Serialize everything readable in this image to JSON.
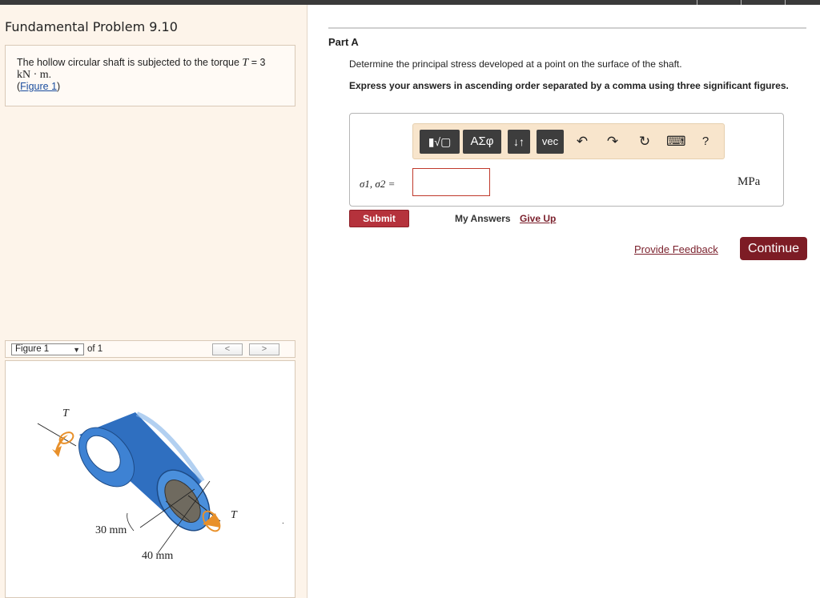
{
  "problem": {
    "title": "Fundamental Problem 9.10",
    "text_prefix": "The hollow circular shaft is subjected to the torque",
    "symbol": "T",
    "equals": "= 3",
    "unit": "kN · m",
    "figure_link": "Figure 1"
  },
  "figure_nav": {
    "select_value": "Figure 1",
    "of_label": "of 1",
    "prev": "<",
    "next": ">"
  },
  "figure": {
    "torque_label_left": "T",
    "torque_label_right": "T",
    "inner_dim": "30 mm",
    "outer_dim": "40 mm"
  },
  "part": {
    "title": "Part A",
    "question": "Determine the principal stress developed at a point on the surface of the shaft.",
    "instructions": "Express your answers in ascending order separated by a comma using three significant figures."
  },
  "toolbar": {
    "templates": "▮√▢",
    "greek": "ΑΣφ",
    "arrows": "↓↑",
    "vec": "vec",
    "undo": "↶",
    "redo": "↷",
    "reset": "↻",
    "keyboard": "⌨",
    "help": "?"
  },
  "answer": {
    "label": "σ1, σ2 =",
    "value": "",
    "unit": "MPa"
  },
  "actions": {
    "submit": "Submit",
    "my_answers": "My Answers",
    "give_up": "Give Up",
    "feedback": "Provide Feedback",
    "continue": "Continue"
  },
  "colors": {
    "left_panel": "#fdf4ea",
    "submit": "#b5323c",
    "continue": "#7d1c25",
    "toolbar": "#f8e5cc",
    "shaft": "#2f6fc0",
    "torque_arrow": "#e8902a"
  }
}
